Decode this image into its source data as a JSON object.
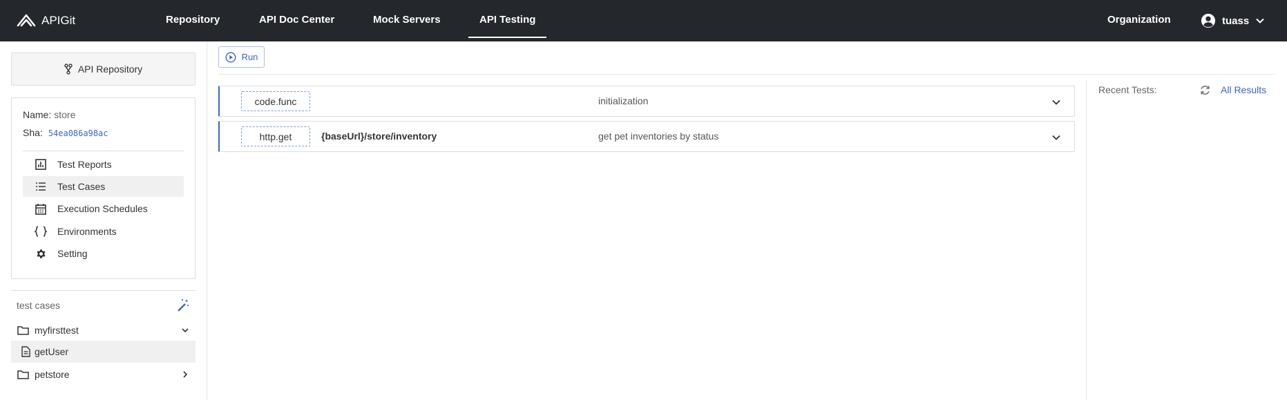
{
  "brand": {
    "name": "APIGit"
  },
  "nav": {
    "items": [
      {
        "label": "Repository"
      },
      {
        "label": "API Doc Center"
      },
      {
        "label": "Mock Servers"
      },
      {
        "label": "API Testing"
      }
    ],
    "active": "API Testing",
    "org_label": "Organization",
    "user_name": "tuass"
  },
  "sidebar": {
    "repo_button": "API Repository",
    "info": {
      "name_label": "Name:",
      "name_value": "store",
      "sha_label": "Sha:",
      "sha_value": "54ea086a98ac"
    },
    "menu": [
      {
        "label": "Test Reports",
        "icon": "chart-icon"
      },
      {
        "label": "Test Cases",
        "icon": "list-icon",
        "selected": true
      },
      {
        "label": "Execution Schedules",
        "icon": "calendar-icon"
      },
      {
        "label": "Environments",
        "icon": "braces-icon"
      },
      {
        "label": "Setting",
        "icon": "gear-icon"
      }
    ],
    "test_cases": {
      "header": "test cases",
      "tree": [
        {
          "label": "myfirsttest",
          "type": "folder",
          "expanded": true
        },
        {
          "label": "getUser",
          "type": "file",
          "selected": true
        },
        {
          "label": "petstore",
          "type": "folder",
          "expanded": false
        }
      ]
    }
  },
  "toolbar": {
    "run_label": "Run"
  },
  "steps": [
    {
      "type": "code.func",
      "path": "",
      "description": "initialization"
    },
    {
      "type": "http.get",
      "path": "{baseUrl}/store/inventory",
      "description": "get pet inventories by status"
    }
  ],
  "recent": {
    "label": "Recent Tests:",
    "all_results": "All Results"
  },
  "colors": {
    "topbar": "#24272c",
    "accent": "#3a66c4"
  }
}
